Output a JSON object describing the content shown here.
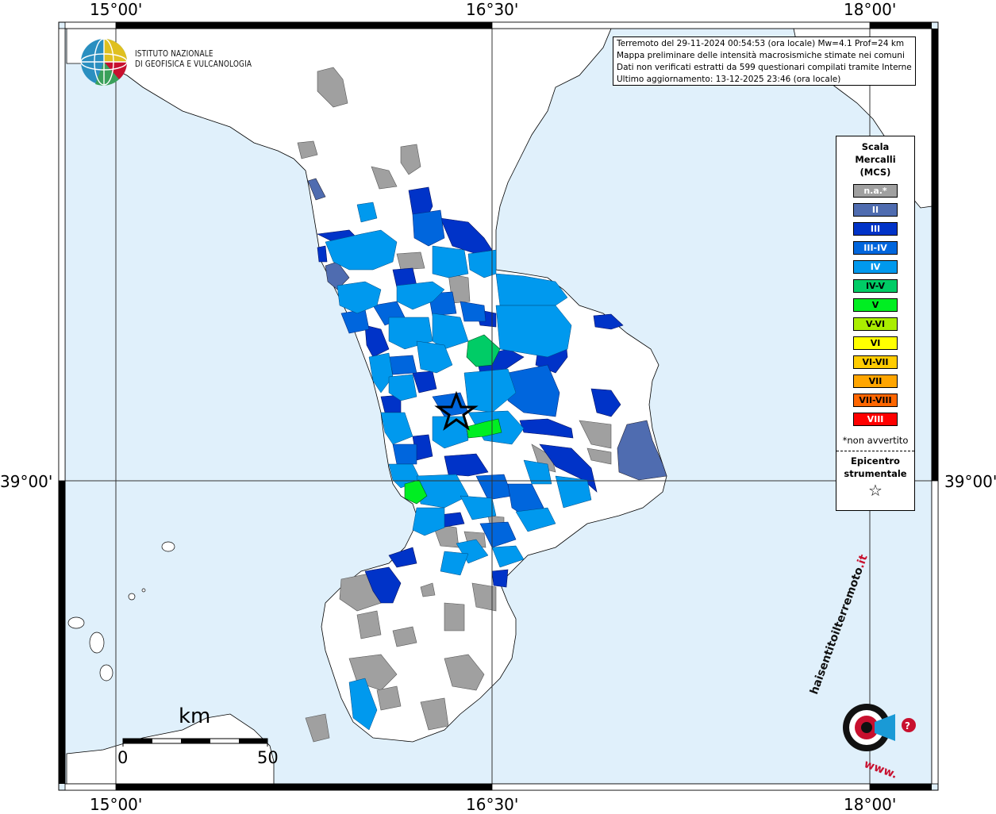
{
  "map": {
    "colors": {
      "sea": "#e0f0fb",
      "land": "#ffffff",
      "border": "#000000",
      "graticule": "#333333"
    },
    "graticule": {
      "top_labels": [
        "15°00'",
        "16°30'",
        "18°00'"
      ],
      "bottom_labels": [
        "15°00'",
        "16°30'",
        "18°00'"
      ],
      "left_label": "39°00'",
      "right_label": "39°00'"
    }
  },
  "logo": {
    "line1": "ISTITUTO NAZIONALE",
    "line2": "DI GEOFISICA E VULCANOLOGIA",
    "icon": "ingv-globe-icon"
  },
  "info": {
    "line1": "Terremoto del 29-11-2024 00:54:53 (ora locale) Mw=4.1 Prof=24 km",
    "line2": "Mappa preliminare delle intensità macrosismiche stimate nei comuni",
    "line3": "Dati non verificati estratti da 599 questionari compilati tramite Internet.",
    "line4": "Ultimo aggiornamento: 13-12-2025 23:46 (ora locale)"
  },
  "legend": {
    "title_line1": "Scala",
    "title_line2": "Mercalli",
    "title_line3": "(MCS)",
    "items": [
      {
        "label": "n.a.*",
        "color": "#a0a0a0",
        "text_color": "#ffffff"
      },
      {
        "label": "II",
        "color": "#4f6cb0",
        "text_color": "#ffffff"
      },
      {
        "label": "III",
        "color": "#0033c8",
        "text_color": "#ffffff"
      },
      {
        "label": "III-IV",
        "color": "#0066dd",
        "text_color": "#ffffff"
      },
      {
        "label": "IV",
        "color": "#0099ee",
        "text_color": "#ffffff"
      },
      {
        "label": "IV-V",
        "color": "#00cc66",
        "text_color": "#000000"
      },
      {
        "label": "V",
        "color": "#00ee22",
        "text_color": "#000000"
      },
      {
        "label": "V-VI",
        "color": "#aaee00",
        "text_color": "#000000"
      },
      {
        "label": "VI",
        "color": "#ffff00",
        "text_color": "#000000"
      },
      {
        "label": "VI-VII",
        "color": "#ffcc00",
        "text_color": "#000000"
      },
      {
        "label": "VII",
        "color": "#ffa500",
        "text_color": "#000000"
      },
      {
        "label": "VII-VIII",
        "color": "#ff6600",
        "text_color": "#000000"
      },
      {
        "label": "VIII",
        "color": "#ff0000",
        "text_color": "#ffffff"
      }
    ],
    "note": "*non avvertito",
    "epicenter_line1": "Epicentro",
    "epicenter_line2": "strumentale",
    "epicenter_icon": "star-outline-icon"
  },
  "scale_bar": {
    "unit": "km",
    "start": "0",
    "end": "50"
  },
  "watermark": {
    "text_main": "haisentitoilterremoto",
    "text_tld": ".it",
    "text_www": "www.",
    "icon": "target-megaphone-icon"
  },
  "epicenter": {
    "icon": "star-icon"
  }
}
